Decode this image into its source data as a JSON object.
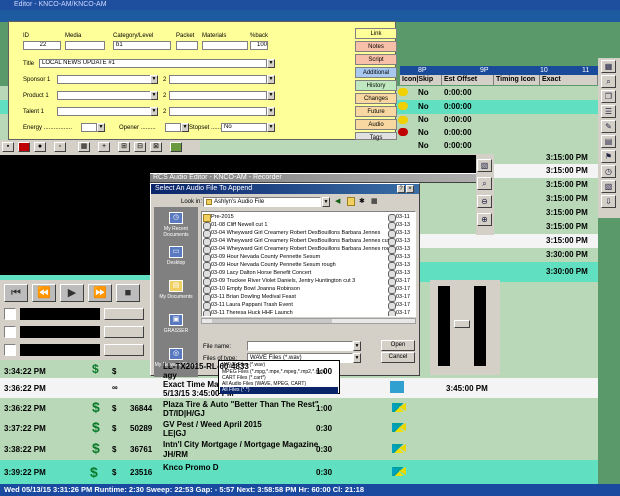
{
  "log": {
    "title": "Editor - KNCO-AM/KNCO-AM",
    "timeline": [
      "8P",
      "9P",
      "10",
      "11"
    ],
    "columns": [
      "Icon|Skip",
      "Est Offset",
      "Timing Icon",
      "Exact"
    ],
    "rows": [
      {
        "time": "",
        "val": "No",
        "offset": "0:00:00"
      },
      {
        "time": "",
        "val": "No",
        "offset": "0:00:00"
      },
      {
        "time": "",
        "val": "No",
        "offset": "0:00:00"
      },
      {
        "time": "",
        "val": "No",
        "offset": "0:00:00"
      },
      {
        "time": "",
        "val": "No",
        "offset": "0:00:00"
      }
    ],
    "right_times": [
      "3:15:00 PM",
      "3:15:00 PM",
      "3:15:00 PM",
      "3:15:00 PM",
      "3:15:00 PM",
      "3:15:00 PM",
      "3:15:00 PM",
      "3:30:00 PM",
      "3:30:00 PM"
    ],
    "bottom_rows": [
      {
        "time": "3:36:22 PM",
        "flag": "∞",
        "cart": "",
        "title": "Exact Time Marker",
        "sub": "5/13/15 3:45:00 PM",
        "len": "",
        "end": "3:45:00 PM",
        "style": "white"
      },
      {
        "time": "3:36:22 PM",
        "flag": "$",
        "cart": "36844",
        "title": "Plaza Tire & Auto \"Better Than The Rest\"",
        "sub": "DT/ID|H/GJ",
        "len": "1:00",
        "end": "",
        "style": "green"
      },
      {
        "time": "3:37:22 PM",
        "flag": "$",
        "cart": "50289",
        "title": "GV Pest / Weed April 2015",
        "sub": "LE|GJ",
        "len": "0:30",
        "end": "",
        "style": "green"
      },
      {
        "time": "3:38:22 PM",
        "flag": "$",
        "cart": "36761",
        "title": "Intn'l City Mortgage / Mortgage Magazine",
        "sub": "JH/RM",
        "len": "0:30",
        "end": "",
        "style": "green"
      },
      {
        "time": "3:39:22 PM",
        "flag": "$",
        "cart": "23516",
        "title": "Knco Promo D",
        "sub": "",
        "len": "0:30",
        "end": "",
        "style": "cyan"
      }
    ],
    "pre_row": {
      "time": "3:34:22 PM",
      "flag": "$",
      "cart": "",
      "title": "agy",
      "len": "1:00",
      "sub": "LL-TX2015-RL-60-4833"
    },
    "status": "Wed 05/13/15 3:31:26 PM   Runtime: 2:30   Sweep: 22:53   Gap: - 5:57   Next: 3:58:58 PM   Hr: 60:00   Cl: 21:18"
  },
  "editor": {
    "fields": {
      "id_label": "ID",
      "id_value": "22",
      "media_label": "Media",
      "media_value": "",
      "category_label": "Category/Level",
      "category_value": "b1",
      "packet_label": "Packet",
      "packet_value": "",
      "materials_label": "Materials",
      "materials_value": "",
      "yuback_label": "%back",
      "yuback_value": "100",
      "title_label": "Title",
      "title_value": "LOCAL NEWS UPDATE #1",
      "sponsor_label": "Sponsor 1",
      "sponsor2": "2",
      "product_label": "Product 1",
      "product2": "2",
      "talent_label": "Talent 1",
      "talent2": "2",
      "energy_label": "Energy .................",
      "opener_label": "Opener .........",
      "stopset_label": "Stopset ...........",
      "stopset_value": "No"
    },
    "tabs": [
      "Link",
      "Notes",
      "Script",
      "Additional",
      "History",
      "Changes",
      "Future",
      "Audio",
      "Tags"
    ]
  },
  "audio_editor": {
    "title": "RCS Audio Editor - KNCO-AM - Recorder"
  },
  "dialog": {
    "title": "Select An Audio File To Append",
    "look_in_label": "Look in:",
    "look_in_value": "Ashlyn's Audio File",
    "places": [
      "My Recent Documents",
      "Desktop",
      "My Documents",
      "GRASSER",
      "My Network Places"
    ],
    "files": [
      {
        "name": "Pre-2015",
        "folder": true
      },
      {
        "name": "01-08 Cliff Newell cut 1",
        "folder": false
      },
      {
        "name": "03-04 Wheyward Girl Creamery Robert DesBouillons Barbara Jennes",
        "folder": false
      },
      {
        "name": "03-04 Wheyward Girl Creamery Robert DesBouillons Barbara Jennes cut 2.",
        "folder": false
      },
      {
        "name": "03-04 Wheyward Girl Creamery Robert DesBouillons Barbara Jennes rough",
        "folder": false
      },
      {
        "name": "03-09 Hour Nevada County Pennette Sesum",
        "folder": false
      },
      {
        "name": "03-09 Hour Nevada County Pennette Sesum rough",
        "folder": false
      },
      {
        "name": "03-09 Lacy Dalton Horse Benefit Concert",
        "folder": false
      },
      {
        "name": "03-09 Truckee River Violet Daniels, Jentry Huntington cut 3",
        "folder": false
      },
      {
        "name": "03-10 Empty Bowl Joanna Robinson",
        "folder": false
      },
      {
        "name": "03-11 Brian Dowling Medival Feast",
        "folder": false
      },
      {
        "name": "03-11 Laura Pappani Trash Event",
        "folder": false
      },
      {
        "name": "03-11 Theresa Huck HHF Launch",
        "folder": false
      }
    ],
    "right_files": [
      "03-11",
      "03-13",
      "03-13",
      "03-13",
      "03-13",
      "03-13",
      "03-13",
      "03-13",
      "03-17",
      "03-17",
      "03-17",
      "03-17",
      "03-17"
    ],
    "file_name_label": "File name:",
    "file_name_value": "",
    "file_type_label": "Files of type:",
    "file_type_value": "WAVE Files (*.wav)",
    "open_label": "Open",
    "cancel_label": "Cancel",
    "type_options": [
      "WAVE Files (*.wav)",
      "MPEG Files (*.mpg,*.mpe,*.mpeg,*.mp2,*.mpa)",
      "CART Files (*.cart*)",
      "All Audio Files (WAVE, MPEG, CART)",
      "All Files (*.*)"
    ]
  }
}
